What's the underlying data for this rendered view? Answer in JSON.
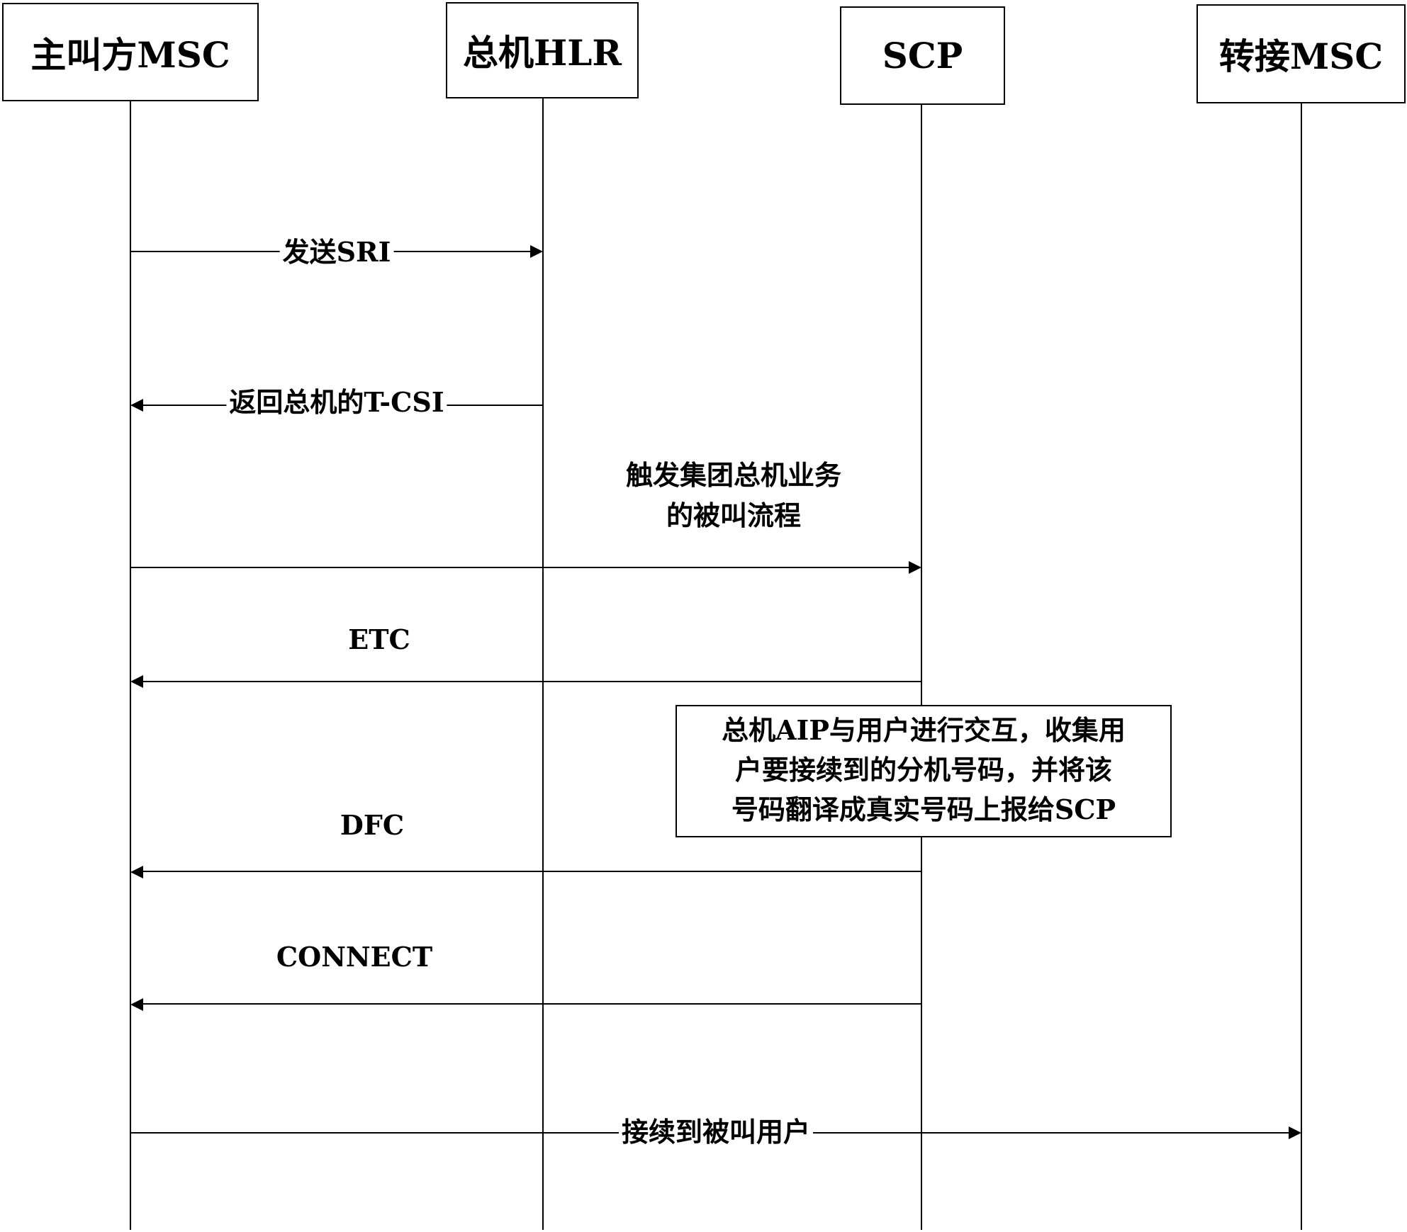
{
  "actors": [
    {
      "id": "calling-msc",
      "label": "主叫方MSC"
    },
    {
      "id": "pbx-hlr",
      "label": "总机HLR"
    },
    {
      "id": "scp",
      "label": "SCP"
    },
    {
      "id": "transfer-msc",
      "label": "转接MSC"
    }
  ],
  "messages": [
    {
      "from": "主叫方MSC",
      "to": "总机HLR",
      "label": "发送SRI"
    },
    {
      "from": "总机HLR",
      "to": "主叫方MSC",
      "label": "返回总机的T-CSI"
    },
    {
      "from": "主叫方MSC",
      "to": "SCP",
      "label_lines": [
        "触发集团总机业务",
        "的被叫流程"
      ]
    },
    {
      "from": "SCP",
      "to": "主叫方MSC",
      "label": "ETC"
    },
    {
      "from": "SCP",
      "to": "主叫方MSC",
      "label": "DFC"
    },
    {
      "from": "SCP",
      "to": "主叫方MSC",
      "label": "CONNECT"
    },
    {
      "from": "主叫方MSC",
      "to": "转接MSC",
      "label": "接续到被叫用户"
    }
  ],
  "note": {
    "attached_to": "SCP",
    "lines": [
      "总机AIP与用户进行交互，收集用",
      "户要接续到的分机号码，并将该",
      "号码翻译成真实号码上报给SCP"
    ]
  }
}
